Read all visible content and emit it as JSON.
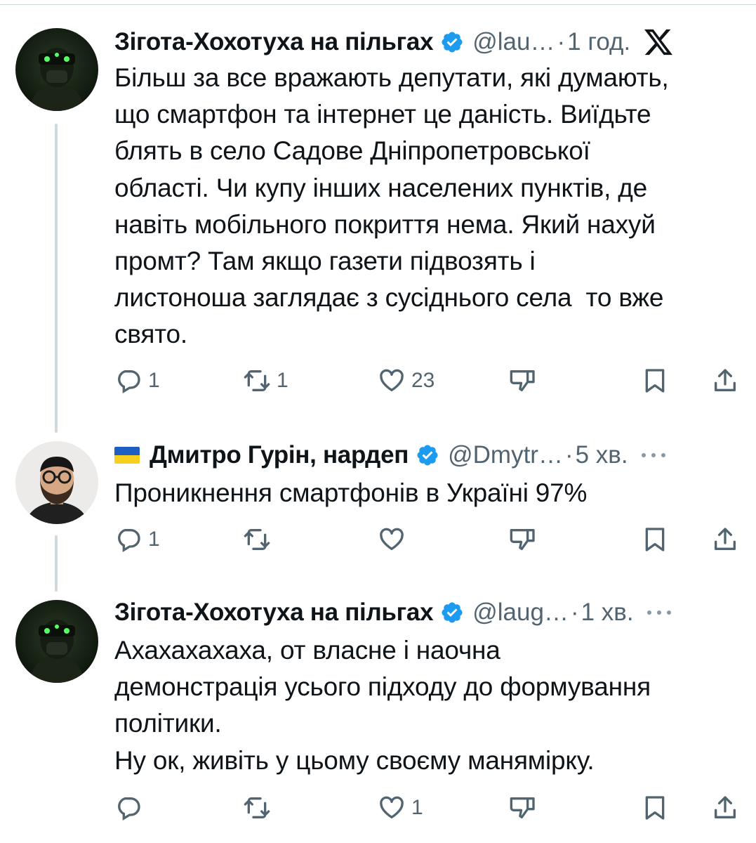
{
  "tweets": [
    {
      "author": "Зігота-Хохотуха на пільгах",
      "handle": "@lau…",
      "sep": "·",
      "time": "1 год.",
      "text": "Більш за все вражають депутати, які думають, \nщо смартфон та інтернет це даність. Виїдьте \nблять в село Садове Дніпропетровської \nобласті. Чи купу інших населених пунктів, де \nнавіть мобільного покриття нема. Який нахуй \nпромт? Там якщо газети підвозять і \nлистоноша заглядає з сусіднього села  то вже \nсвято.",
      "replies": "1",
      "reposts": "1",
      "likes": "23"
    },
    {
      "author": "Дмитро Гурін, нардеп",
      "handle": "@Dmytr…",
      "sep": "·",
      "time": "5 хв.",
      "text": "Проникнення смартфонів в Україні 97%",
      "replies": "1",
      "reposts": "",
      "likes": ""
    },
    {
      "author": "Зігота-Хохотуха на пільгах",
      "handle": "@laug…",
      "sep": "·",
      "time": "1 хв.",
      "text": "Ахахахахаха, от власне і наочна \nдемонстрація усього підходу до формування \nполітики.\nНу ок, живіть у цьому своєму манямірку.",
      "replies": "",
      "reposts": "",
      "likes": "1"
    }
  ],
  "icons": {
    "verified": "verified-badge-icon",
    "platform": "x-logo-icon",
    "more": "more-dots-icon",
    "reply": "reply-icon",
    "repost": "repost-icon",
    "like": "like-icon",
    "dislike": "dislike-icon",
    "bookmark": "bookmark-icon",
    "share": "share-icon"
  },
  "colors": {
    "text": "#0f1419",
    "muted": "#536471",
    "verified": "#1d9bf0",
    "thread_line": "#cfd9de"
  }
}
